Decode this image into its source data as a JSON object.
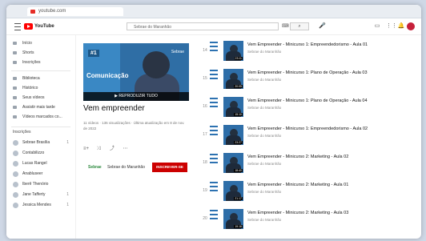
{
  "browser": {
    "tab_title": "youtube.com"
  },
  "topbar": {
    "logo_text": "YouTube",
    "search_placeholder": "Sebrae do Maranhão",
    "kbd_glyph": "⌨",
    "search_glyph": "⌕",
    "mic_glyph": "🎤",
    "icons": [
      "video-camera-icon",
      "apps-grid-icon",
      "bell-icon"
    ],
    "icon_glyphs": [
      "▭",
      "⋮⋮",
      "🔔"
    ]
  },
  "sidebar": {
    "items": [
      {
        "label": "Início"
      },
      {
        "label": "Shorts"
      },
      {
        "label": "Inscrições"
      },
      {
        "label": "Biblioteca"
      },
      {
        "label": "Histórico"
      },
      {
        "label": "Seus vídeos"
      },
      {
        "label": "Assistir mais tarde"
      },
      {
        "label": "Vídeos marcados co..."
      }
    ],
    "subs_heading": "Inscrições",
    "subscriptions": [
      {
        "label": "Sebrae Brasília",
        "count": "1"
      },
      {
        "label": "Contabilizzo"
      },
      {
        "label": "Lucas Rangel"
      },
      {
        "label": "Anabluseer"
      },
      {
        "label": "Iberê Thenório"
      },
      {
        "label": "Jane Tafferty",
        "count": "1"
      },
      {
        "label": "Jessica Mendes",
        "count": "1"
      }
    ]
  },
  "playlist": {
    "badge": "#1",
    "thumb_word": "Comunicação",
    "thumb_tag": "Sebrae",
    "play_all": "▶ REPRODUZIR TUDO",
    "title": "Vem empreender",
    "meta": "11 vídeos · 136 visualizações · Última atualização em 8 de nov. de 2022",
    "actions": [
      "≡+",
      "⤨",
      "⤴",
      "⋯"
    ],
    "owner_logo": "Sebrae",
    "owner": "Sebrae do Maranhão",
    "subscribe": "INSCREVER-SE"
  },
  "videos": [
    {
      "index": "14",
      "title": "Vem Empreender - Minicurso 1: Empreendedorismo - Aula 01",
      "channel": "Sebrae do Maranhão",
      "duration": "23:11"
    },
    {
      "index": "15",
      "title": "Vem Empreender - Minicurso 1: Plano de Operação - Aula 03",
      "channel": "Sebrae do Maranhão",
      "duration": "20:05"
    },
    {
      "index": "16",
      "title": "Vem Empreender - Minicurso 1: Plano de Operação - Aula 04",
      "channel": "Sebrae do Maranhão",
      "duration": "15:10"
    },
    {
      "index": "17",
      "title": "Vem Empreender - Minicurso 1: Empreendedorismo - Aula 02",
      "channel": "Sebrae do Maranhão",
      "duration": "23:27"
    },
    {
      "index": "18",
      "title": "Vem Empreender - Minicurso 2: Marketing - Aula 02",
      "channel": "Sebrae do Maranhão",
      "duration": "18:40"
    },
    {
      "index": "19",
      "title": "Vem Empreender - Minicurso 2: Marketing - Aula 01",
      "channel": "Sebrae do Maranhão",
      "duration": "21:17"
    },
    {
      "index": "20",
      "title": "Vem Empreender - Minicurso 2: Marketing - Aula 03",
      "channel": "Sebrae do Maranhão",
      "duration": "19:16"
    }
  ]
}
